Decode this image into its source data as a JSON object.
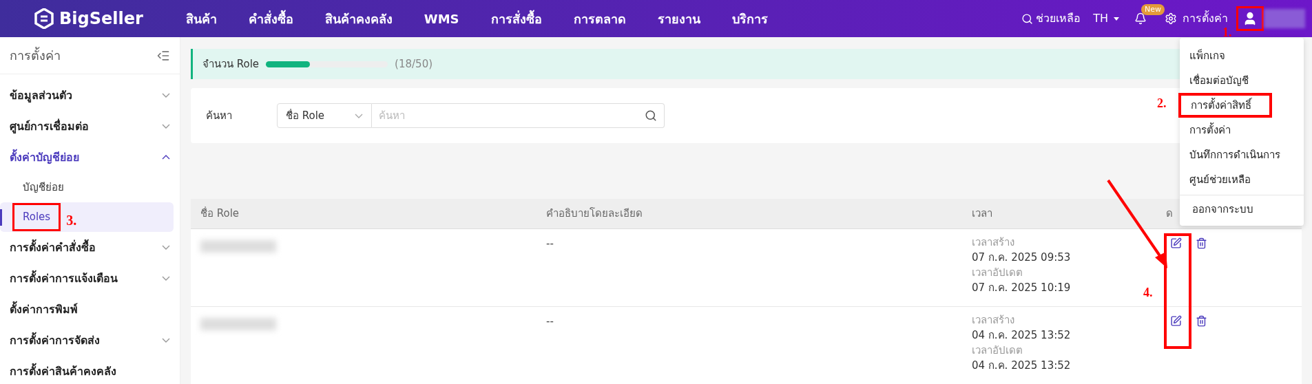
{
  "topbar": {
    "logo": "BigSeller",
    "nav": [
      "สินค้า",
      "คำสั่งซื้อ",
      "สินค้าคงคลัง",
      "WMS",
      "การสั่งซื้อ",
      "การตลาด",
      "รายงาน",
      "บริการ"
    ],
    "help": "ช่วยเหลือ",
    "language": "TH",
    "new_badge": "New",
    "settings": "การตั้งค่า",
    "user_highlighted": true
  },
  "user_menu": {
    "items": [
      {
        "label": "แพ็กเกจ",
        "highlighted": false
      },
      {
        "label": "เชื่อมต่อบัญชี",
        "highlighted": false
      },
      {
        "label": "การตั้งค่าสิทธิ์",
        "highlighted": true
      },
      {
        "label": "การตั้งค่า",
        "highlighted": false
      },
      {
        "label": "บันทึกการดำเนินการ",
        "highlighted": false
      },
      {
        "label": "ศูนย์ช่วยเหลือ",
        "highlighted": false
      }
    ],
    "logout": "ออกจากระบบ"
  },
  "sidebar": {
    "title": "การตั้งค่า",
    "items": [
      {
        "kind": "group",
        "label": "ข้อมูลส่วนตัว",
        "expanded": false
      },
      {
        "kind": "group",
        "label": "ศูนย์การเชื่อมต่อ",
        "expanded": false
      },
      {
        "kind": "group",
        "label": "ตั้งค่าบัญชีย่อย",
        "expanded": true,
        "children": [
          {
            "label": "บัญชีย่อย",
            "selected": false,
            "highlighted": false
          },
          {
            "label": "Roles",
            "selected": true,
            "highlighted": true
          }
        ]
      },
      {
        "kind": "group",
        "label": "การตั้งค่าคำสั่งซื้อ",
        "expanded": false
      },
      {
        "kind": "group",
        "label": "การตั้งค่าการแจ้งเตือน",
        "expanded": false
      },
      {
        "kind": "link",
        "label": "ตั้งค่าการพิมพ์"
      },
      {
        "kind": "group",
        "label": "การตั้งค่าการจัดส่ง",
        "expanded": false
      },
      {
        "kind": "link",
        "label": "การตั้งค่าสินค้าคงคลัง"
      }
    ]
  },
  "role_quota": {
    "label": "จำนวน Role",
    "level": 0.36,
    "reading": "(18/50)"
  },
  "search": {
    "label": "ค้นหา",
    "field_select": "ชื่อ Role",
    "placeholder": "ค้นหา"
  },
  "table": {
    "columns": [
      "ชื่อ Role",
      "คำอธิบายโดยละเอียด",
      "เวลา",
      "ด"
    ],
    "actions_highlighted": true,
    "rows": [
      {
        "description": "--",
        "created_label": "เวลาสร้าง",
        "created": "07 ก.ค. 2025 09:53",
        "updated_label": "เวลาอัปเดต",
        "updated": "07 ก.ค. 2025 10:19"
      },
      {
        "description": "--",
        "created_label": "เวลาสร้าง",
        "created": "04 ก.ค. 2025 13:52",
        "updated_label": "เวลาอัปเดต",
        "updated": "04 ก.ค. 2025 13:52"
      }
    ]
  },
  "annotations": [
    {
      "label": "1."
    },
    {
      "label": "2."
    },
    {
      "label": "3."
    },
    {
      "label": "4."
    }
  ]
}
